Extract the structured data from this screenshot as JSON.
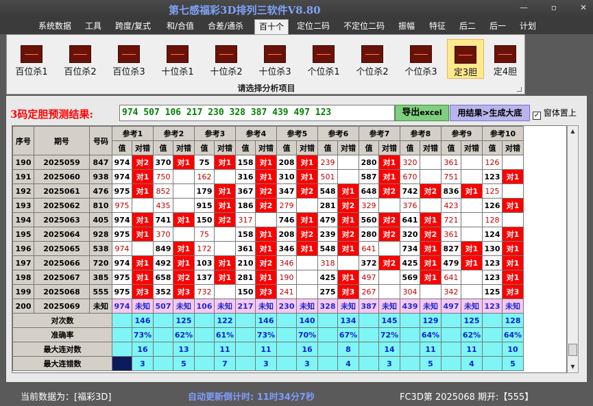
{
  "app": {
    "title": "第七感福彩3D排列三软件V8.80",
    "window_controls": [
      "—",
      "▫",
      "✕"
    ]
  },
  "menu": [
    {
      "label": "系统数据"
    },
    {
      "label": "工具"
    },
    {
      "label": "跨度/复式"
    },
    {
      "label": "和/合值"
    },
    {
      "label": "合差/通杀"
    },
    {
      "label": "百十个",
      "active": true
    },
    {
      "label": "定位二码"
    },
    {
      "label": "不定位二码"
    },
    {
      "label": "振幅"
    },
    {
      "label": "特征"
    },
    {
      "label": "后二"
    },
    {
      "label": "后一"
    },
    {
      "label": "计划"
    }
  ],
  "ribbon": {
    "buttons": [
      {
        "label": "百位杀1"
      },
      {
        "label": "百位杀2"
      },
      {
        "label": "百位杀3"
      },
      {
        "label": "十位杀1"
      },
      {
        "label": "十位杀2"
      },
      {
        "label": "十位杀3"
      },
      {
        "label": "个位杀1"
      },
      {
        "label": "个位杀2"
      },
      {
        "label": "个位杀3"
      },
      {
        "label": "定3胆",
        "selected": true
      },
      {
        "label": "定4胆"
      }
    ],
    "caption": "请选择分析项目"
  },
  "prediction": {
    "label": "3码定胆预测结果:",
    "value": "974 507 106 217 230 328 387 439 497 123",
    "export_label": "导出",
    "export_suffix": "excel",
    "generate_label": "用结果>生成大底",
    "on_top_label": "窗体置上",
    "on_top_checked": "✓"
  },
  "table": {
    "headers": {
      "seq": "序号",
      "period": "期号",
      "number": "号码",
      "value": "值",
      "match": "对错",
      "refs": [
        "参考1",
        "参考2",
        "参考3",
        "参考4",
        "参考5",
        "参考6",
        "参考7",
        "参考8",
        "参考9",
        "参考10"
      ]
    },
    "rows": [
      {
        "seq": "190",
        "period": "2025059",
        "number": "847",
        "cells": [
          [
            "974",
            "对2"
          ],
          [
            "370",
            "对1"
          ],
          [
            "75",
            "对1"
          ],
          [
            "158",
            "对1"
          ],
          [
            "208",
            "对1"
          ],
          [
            "239",
            ""
          ],
          [
            "280",
            "对1"
          ],
          [
            "320",
            ""
          ],
          [
            "361",
            ""
          ],
          [
            "126",
            ""
          ]
        ]
      },
      {
        "seq": "191",
        "period": "2025060",
        "number": "938",
        "cells": [
          [
            "974",
            "对1"
          ],
          [
            "750",
            ""
          ],
          [
            "162",
            ""
          ],
          [
            "316",
            "对1"
          ],
          [
            "310",
            "对1"
          ],
          [
            "501",
            ""
          ],
          [
            "587",
            "对1"
          ],
          [
            "670",
            ""
          ],
          [
            "751",
            ""
          ],
          [
            "123",
            "对1"
          ]
        ]
      },
      {
        "seq": "192",
        "period": "2025061",
        "number": "476",
        "cells": [
          [
            "975",
            "对1"
          ],
          [
            "852",
            ""
          ],
          [
            "179",
            "对1"
          ],
          [
            "367",
            "对2"
          ],
          [
            "347",
            "对2"
          ],
          [
            "548",
            "对1"
          ],
          [
            "648",
            "对2"
          ],
          [
            "742",
            "对2"
          ],
          [
            "836",
            "对1"
          ],
          [
            "125",
            ""
          ]
        ]
      },
      {
        "seq": "193",
        "period": "2025062",
        "number": "810",
        "cells": [
          [
            "975",
            ""
          ],
          [
            "435",
            ""
          ],
          [
            "915",
            "对1"
          ],
          [
            "186",
            "对2"
          ],
          [
            "279",
            ""
          ],
          [
            "281",
            "对2"
          ],
          [
            "329",
            ""
          ],
          [
            "376",
            ""
          ],
          [
            "423",
            ""
          ],
          [
            "126",
            "对1"
          ]
        ]
      },
      {
        "seq": "194",
        "period": "2025063",
        "number": "405",
        "cells": [
          [
            "974",
            "对1"
          ],
          [
            "741",
            "对1"
          ],
          [
            "150",
            "对2"
          ],
          [
            "317",
            ""
          ],
          [
            "746",
            "对1"
          ],
          [
            "479",
            "对1"
          ],
          [
            "560",
            "对2"
          ],
          [
            "641",
            "对1"
          ],
          [
            "721",
            ""
          ],
          [
            "128",
            ""
          ]
        ]
      },
      {
        "seq": "195",
        "period": "2025064",
        "number": "928",
        "cells": [
          [
            "975",
            "对1"
          ],
          [
            "370",
            ""
          ],
          [
            "75",
            ""
          ],
          [
            "158",
            "对1"
          ],
          [
            "208",
            "对2"
          ],
          [
            "239",
            "对2"
          ],
          [
            "280",
            "对2"
          ],
          [
            "320",
            "对2"
          ],
          [
            "361",
            ""
          ],
          [
            "124",
            "对1"
          ]
        ]
      },
      {
        "seq": "196",
        "period": "2025065",
        "number": "538",
        "cells": [
          [
            "974",
            ""
          ],
          [
            "849",
            "对1"
          ],
          [
            "172",
            ""
          ],
          [
            "361",
            "对1"
          ],
          [
            "346",
            "对1"
          ],
          [
            "548",
            "对1"
          ],
          [
            "641",
            ""
          ],
          [
            "734",
            "对1"
          ],
          [
            "827",
            "对1"
          ],
          [
            "130",
            "对1"
          ]
        ]
      },
      {
        "seq": "197",
        "period": "2025066",
        "number": "720",
        "cells": [
          [
            "974",
            "对1"
          ],
          [
            "492",
            "对1"
          ],
          [
            "103",
            "对1"
          ],
          [
            "210",
            "对2"
          ],
          [
            "346",
            ""
          ],
          [
            "318",
            ""
          ],
          [
            "372",
            "对2"
          ],
          [
            "425",
            "对1"
          ],
          [
            "479",
            "对1"
          ],
          [
            "123",
            "对1"
          ]
        ]
      },
      {
        "seq": "198",
        "period": "2025067",
        "number": "385",
        "cells": [
          [
            "975",
            "对1"
          ],
          [
            "658",
            "对2"
          ],
          [
            "137",
            "对1"
          ],
          [
            "281",
            "对1"
          ],
          [
            "190",
            ""
          ],
          [
            "425",
            "对1"
          ],
          [
            "497",
            ""
          ],
          [
            "569",
            "对1"
          ],
          [
            "641",
            ""
          ],
          [
            "123",
            "对1"
          ]
        ]
      },
      {
        "seq": "199",
        "period": "2025068",
        "number": "555",
        "cells": [
          [
            "975",
            "对3"
          ],
          [
            "352",
            "对3"
          ],
          [
            "732",
            ""
          ],
          [
            "150",
            "对3"
          ],
          [
            "241",
            ""
          ],
          [
            "275",
            "对3"
          ],
          [
            "267",
            ""
          ],
          [
            "304",
            ""
          ],
          [
            "342",
            ""
          ],
          [
            "125",
            "对3"
          ]
        ]
      }
    ],
    "pending": {
      "seq": "200",
      "period": "2025069",
      "number": "未知",
      "values": [
        "974",
        "507",
        "106",
        "217",
        "230",
        "328",
        "387",
        "439",
        "497",
        "123"
      ],
      "match_text": "未知"
    },
    "stats": [
      {
        "label": "对次数",
        "values": [
          "146",
          "125",
          "122",
          "146",
          "140",
          "134",
          "145",
          "129",
          "125",
          "128"
        ]
      },
      {
        "label": "准确率",
        "values": [
          "73%",
          "62%",
          "61%",
          "73%",
          "70%",
          "67%",
          "72%",
          "64%",
          "62%",
          "64%"
        ]
      },
      {
        "label": "最大连对数",
        "values": [
          "16",
          "13",
          "11",
          "11",
          "16",
          "8",
          "14",
          "11",
          "11",
          "10"
        ]
      },
      {
        "label": "最大连错数",
        "values": [
          "3",
          "5",
          "7",
          "3",
          "3",
          "4",
          "3",
          "5",
          "4",
          "5"
        ]
      }
    ]
  },
  "status": {
    "source": "当前数据为：[福彩3D]",
    "countdown": "自动更新倒计时:  11时34分7秒",
    "issue": "FC3D第 2025068 期开:【555】"
  },
  "colors": {
    "hit": "#ff0000",
    "pending": "#f7c8f2",
    "stats": "#7ff5f5",
    "title": "#7fa3f7"
  }
}
